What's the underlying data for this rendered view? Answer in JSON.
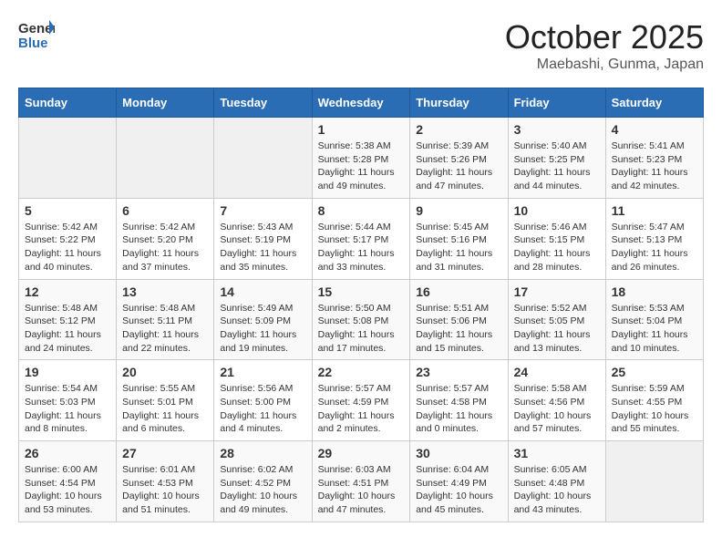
{
  "logo": {
    "general": "General",
    "blue": "Blue"
  },
  "header": {
    "month": "October 2025",
    "location": "Maebashi, Gunma, Japan"
  },
  "weekdays": [
    "Sunday",
    "Monday",
    "Tuesday",
    "Wednesday",
    "Thursday",
    "Friday",
    "Saturday"
  ],
  "weeks": [
    [
      {
        "day": "",
        "info": ""
      },
      {
        "day": "",
        "info": ""
      },
      {
        "day": "",
        "info": ""
      },
      {
        "day": "1",
        "info": "Sunrise: 5:38 AM\nSunset: 5:28 PM\nDaylight: 11 hours\nand 49 minutes."
      },
      {
        "day": "2",
        "info": "Sunrise: 5:39 AM\nSunset: 5:26 PM\nDaylight: 11 hours\nand 47 minutes."
      },
      {
        "day": "3",
        "info": "Sunrise: 5:40 AM\nSunset: 5:25 PM\nDaylight: 11 hours\nand 44 minutes."
      },
      {
        "day": "4",
        "info": "Sunrise: 5:41 AM\nSunset: 5:23 PM\nDaylight: 11 hours\nand 42 minutes."
      }
    ],
    [
      {
        "day": "5",
        "info": "Sunrise: 5:42 AM\nSunset: 5:22 PM\nDaylight: 11 hours\nand 40 minutes."
      },
      {
        "day": "6",
        "info": "Sunrise: 5:42 AM\nSunset: 5:20 PM\nDaylight: 11 hours\nand 37 minutes."
      },
      {
        "day": "7",
        "info": "Sunrise: 5:43 AM\nSunset: 5:19 PM\nDaylight: 11 hours\nand 35 minutes."
      },
      {
        "day": "8",
        "info": "Sunrise: 5:44 AM\nSunset: 5:17 PM\nDaylight: 11 hours\nand 33 minutes."
      },
      {
        "day": "9",
        "info": "Sunrise: 5:45 AM\nSunset: 5:16 PM\nDaylight: 11 hours\nand 31 minutes."
      },
      {
        "day": "10",
        "info": "Sunrise: 5:46 AM\nSunset: 5:15 PM\nDaylight: 11 hours\nand 28 minutes."
      },
      {
        "day": "11",
        "info": "Sunrise: 5:47 AM\nSunset: 5:13 PM\nDaylight: 11 hours\nand 26 minutes."
      }
    ],
    [
      {
        "day": "12",
        "info": "Sunrise: 5:48 AM\nSunset: 5:12 PM\nDaylight: 11 hours\nand 24 minutes."
      },
      {
        "day": "13",
        "info": "Sunrise: 5:48 AM\nSunset: 5:11 PM\nDaylight: 11 hours\nand 22 minutes."
      },
      {
        "day": "14",
        "info": "Sunrise: 5:49 AM\nSunset: 5:09 PM\nDaylight: 11 hours\nand 19 minutes."
      },
      {
        "day": "15",
        "info": "Sunrise: 5:50 AM\nSunset: 5:08 PM\nDaylight: 11 hours\nand 17 minutes."
      },
      {
        "day": "16",
        "info": "Sunrise: 5:51 AM\nSunset: 5:06 PM\nDaylight: 11 hours\nand 15 minutes."
      },
      {
        "day": "17",
        "info": "Sunrise: 5:52 AM\nSunset: 5:05 PM\nDaylight: 11 hours\nand 13 minutes."
      },
      {
        "day": "18",
        "info": "Sunrise: 5:53 AM\nSunset: 5:04 PM\nDaylight: 11 hours\nand 10 minutes."
      }
    ],
    [
      {
        "day": "19",
        "info": "Sunrise: 5:54 AM\nSunset: 5:03 PM\nDaylight: 11 hours\nand 8 minutes."
      },
      {
        "day": "20",
        "info": "Sunrise: 5:55 AM\nSunset: 5:01 PM\nDaylight: 11 hours\nand 6 minutes."
      },
      {
        "day": "21",
        "info": "Sunrise: 5:56 AM\nSunset: 5:00 PM\nDaylight: 11 hours\nand 4 minutes."
      },
      {
        "day": "22",
        "info": "Sunrise: 5:57 AM\nSunset: 4:59 PM\nDaylight: 11 hours\nand 2 minutes."
      },
      {
        "day": "23",
        "info": "Sunrise: 5:57 AM\nSunset: 4:58 PM\nDaylight: 11 hours\nand 0 minutes."
      },
      {
        "day": "24",
        "info": "Sunrise: 5:58 AM\nSunset: 4:56 PM\nDaylight: 10 hours\nand 57 minutes."
      },
      {
        "day": "25",
        "info": "Sunrise: 5:59 AM\nSunset: 4:55 PM\nDaylight: 10 hours\nand 55 minutes."
      }
    ],
    [
      {
        "day": "26",
        "info": "Sunrise: 6:00 AM\nSunset: 4:54 PM\nDaylight: 10 hours\nand 53 minutes."
      },
      {
        "day": "27",
        "info": "Sunrise: 6:01 AM\nSunset: 4:53 PM\nDaylight: 10 hours\nand 51 minutes."
      },
      {
        "day": "28",
        "info": "Sunrise: 6:02 AM\nSunset: 4:52 PM\nDaylight: 10 hours\nand 49 minutes."
      },
      {
        "day": "29",
        "info": "Sunrise: 6:03 AM\nSunset: 4:51 PM\nDaylight: 10 hours\nand 47 minutes."
      },
      {
        "day": "30",
        "info": "Sunrise: 6:04 AM\nSunset: 4:49 PM\nDaylight: 10 hours\nand 45 minutes."
      },
      {
        "day": "31",
        "info": "Sunrise: 6:05 AM\nSunset: 4:48 PM\nDaylight: 10 hours\nand 43 minutes."
      },
      {
        "day": "",
        "info": ""
      }
    ]
  ]
}
